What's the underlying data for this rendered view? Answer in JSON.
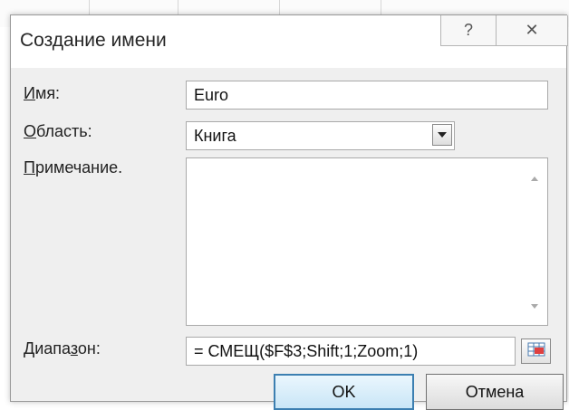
{
  "dialog": {
    "title": "Создание имени",
    "help_icon": "?",
    "close_icon": "✕"
  },
  "fields": {
    "name_label_u": "И",
    "name_label_rest": "мя:",
    "name_value": "Euro",
    "scope_label_u": "О",
    "scope_label_rest": "бласть:",
    "scope_value": "Книга",
    "comment_label_u": "П",
    "comment_label_rest": "римечание.",
    "comment_value": "",
    "range_label_pre": "Диапа",
    "range_label_u": "з",
    "range_label_post": "он:",
    "range_value": "= СМЕЩ($F$3;Shift;1;Zoom;1)"
  },
  "buttons": {
    "ok": "OK",
    "cancel": "Отмена"
  },
  "icons": {
    "dropdown": "chevron-down-icon",
    "range_select": "range-select-icon"
  }
}
